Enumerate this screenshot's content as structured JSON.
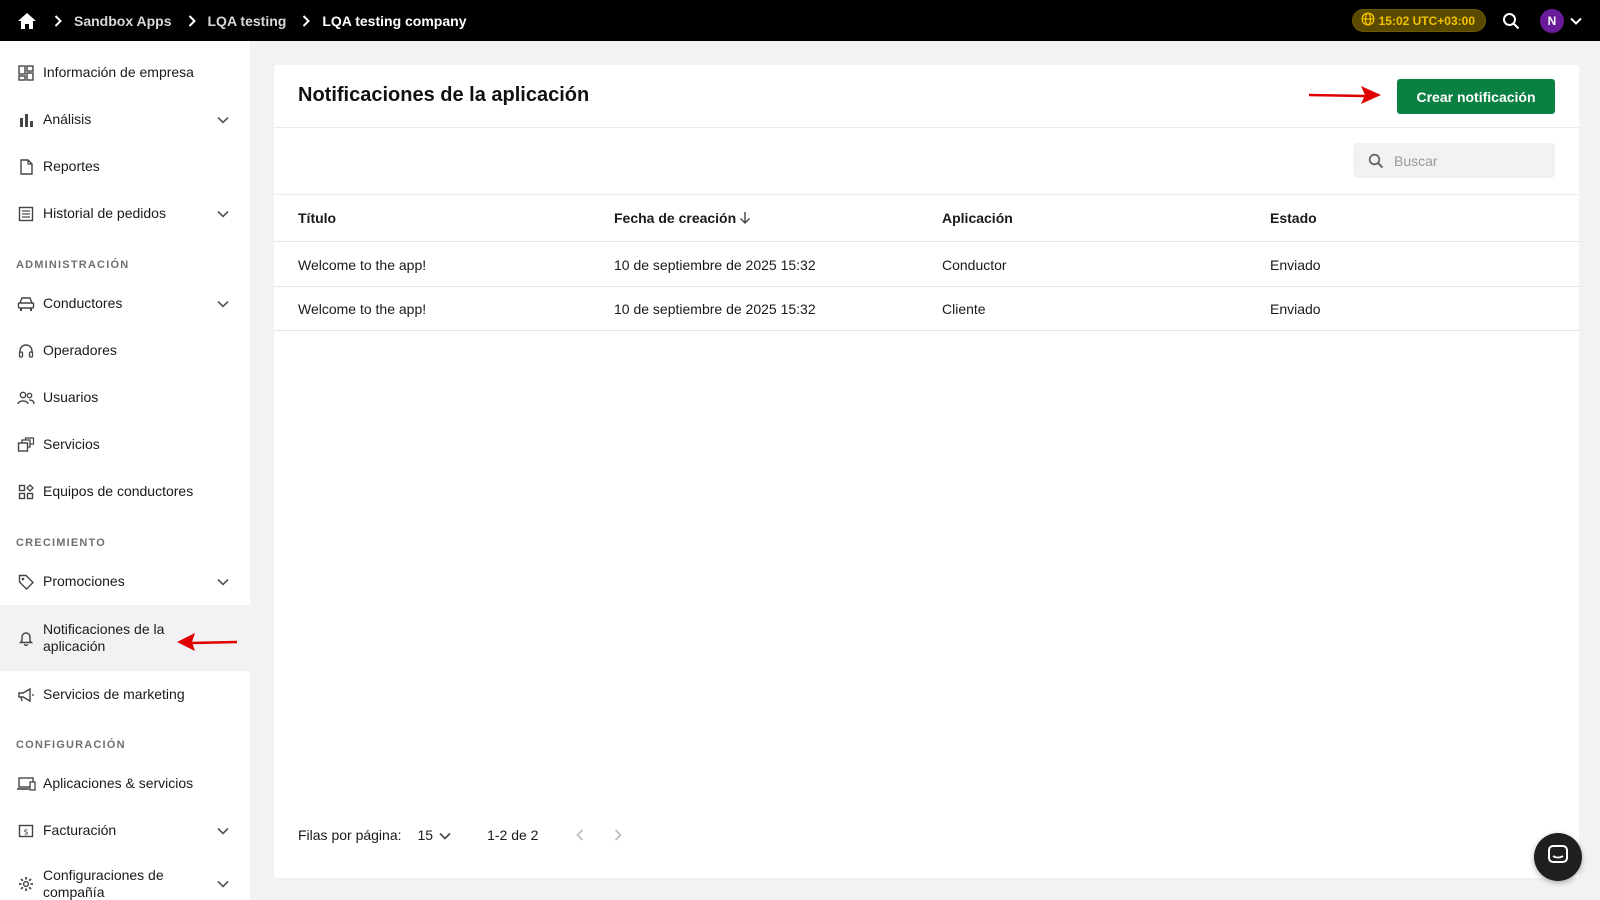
{
  "breadcrumb": {
    "items": [
      "Sandbox Apps",
      "LQA testing",
      "LQA testing company"
    ]
  },
  "topbar": {
    "timezone": "15:02 UTC+03:00",
    "avatar_initial": "N"
  },
  "sidebar": {
    "items": [
      {
        "label": "Información de empresa",
        "icon": "dashboard-icon"
      },
      {
        "label": "Análisis",
        "icon": "bar-chart-icon",
        "expandable": true
      },
      {
        "label": "Reportes",
        "icon": "report-icon"
      },
      {
        "label": "Historial de pedidos",
        "icon": "list-icon",
        "expandable": true
      }
    ],
    "section_admin": "ADMINISTRACIÓN",
    "admin_items": [
      {
        "label": "Conductores",
        "icon": "car-icon",
        "expandable": true
      },
      {
        "label": "Operadores",
        "icon": "headset-icon"
      },
      {
        "label": "Usuarios",
        "icon": "users-icon"
      },
      {
        "label": "Servicios",
        "icon": "services-icon"
      },
      {
        "label": "Equipos de conductores",
        "icon": "teams-icon"
      }
    ],
    "section_growth": "CRECIMIENTO",
    "growth_items": [
      {
        "label": "Promociones",
        "icon": "tag-icon",
        "expandable": true
      },
      {
        "label": "Notificaciones de la aplicación",
        "icon": "bell-icon",
        "active": true
      },
      {
        "label": "Servicios de marketing",
        "icon": "megaphone-icon"
      }
    ],
    "section_config": "CONFIGURACIÓN",
    "config_items": [
      {
        "label": "Aplicaciones & servicios",
        "icon": "devices-icon"
      },
      {
        "label": "Facturación",
        "icon": "billing-icon",
        "expandable": true
      },
      {
        "label": "Configuraciones de compañía",
        "icon": "gear-icon",
        "expandable": true
      }
    ]
  },
  "main": {
    "title": "Notificaciones de la aplicación",
    "create_button": "Crear notificación",
    "search_placeholder": "Buscar",
    "columns": [
      "Título",
      "Fecha de creación",
      "Aplicación",
      "Estado"
    ],
    "rows": [
      {
        "title": "Welcome to the app!",
        "date": "10 de septiembre de 2025 15:32",
        "app": "Conductor",
        "status": "Enviado"
      },
      {
        "title": "Welcome to the app!",
        "date": "10 de septiembre de 2025 15:32",
        "app": "Cliente",
        "status": "Enviado"
      }
    ],
    "pagination": {
      "rows_per_page_label": "Filas por página:",
      "rows_per_page_value": "15",
      "range": "1-2 de 2"
    }
  },
  "colors": {
    "primary_button": "#0b8043",
    "annotation_arrow": "#e00000",
    "timezone_badge": "#f2c200",
    "avatar": "#6a1b9a"
  }
}
